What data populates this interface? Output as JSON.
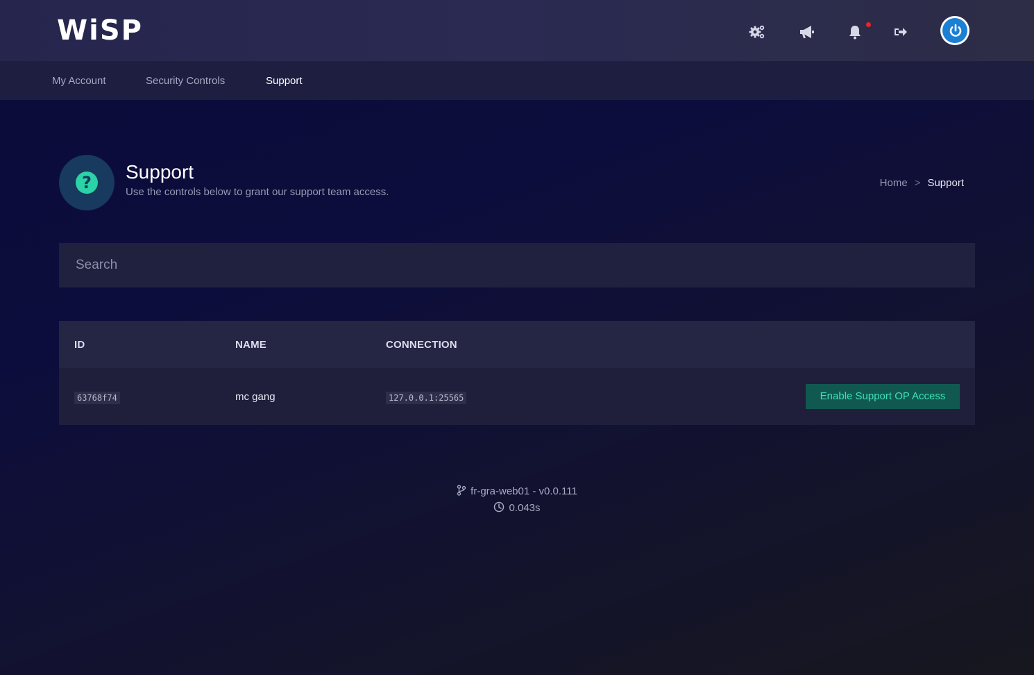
{
  "brand": {
    "logo_text": "WiSP"
  },
  "topbar": {
    "icons": [
      "gears-icon",
      "megaphone-icon",
      "bell-icon",
      "sign-out-icon",
      "power-icon"
    ],
    "notification_dot_color": "#e3262e"
  },
  "nav": {
    "items": [
      {
        "label": "My Account"
      },
      {
        "label": "Security Controls"
      },
      {
        "label": "Support",
        "active": true
      }
    ]
  },
  "header": {
    "title": "Support",
    "subtitle": "Use the controls below to grant our support team access.",
    "breadcrumb": {
      "home": "Home",
      "separator": ">",
      "current": "Support"
    }
  },
  "search": {
    "placeholder": "Search",
    "value": ""
  },
  "table": {
    "columns": [
      "ID",
      "NAME",
      "CONNECTION"
    ],
    "rows": [
      {
        "id": "63768f74",
        "name": "mc gang",
        "connection": "127.0.0.1:25565",
        "action_label": "Enable Support OP Access"
      }
    ]
  },
  "footer": {
    "node_version": "fr-gra-web01 - v0.0.111",
    "render_time": "0.043s"
  },
  "colors": {
    "accent": "#2bd3a6",
    "button_bg": "#115950",
    "avatar_blue": "#1b7fd3"
  }
}
